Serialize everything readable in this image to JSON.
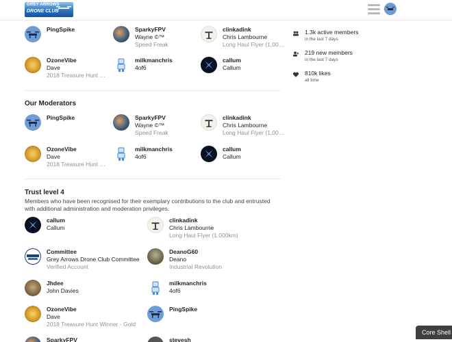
{
  "header": {
    "logo_line1": "GREY ARROWS",
    "logo_line2": "DRONE CLUB"
  },
  "top_group": [
    {
      "username": "PingSpike",
      "name": "",
      "title": "",
      "avatar": "drone-avatar"
    },
    {
      "username": "SparkyFPV",
      "name": "Wayne ©™",
      "title": "Speed Freak",
      "avatar": "photo-avatar"
    },
    {
      "username": "clinkadink",
      "name": "Chris Lambourne",
      "title": "Long Haul Flyer (1,00…",
      "avatar": "drone-silhouette-avatar"
    },
    {
      "username": "OzoneVibe",
      "name": "Dave",
      "title": "2018 Treasure Hunt …",
      "avatar": "sun-avatar"
    },
    {
      "username": "milkmanchris",
      "name": "4of6",
      "title": "",
      "avatar": "robot-avatar"
    },
    {
      "username": "callum",
      "name": "Callum",
      "title": "",
      "avatar": "x-logo-avatar"
    }
  ],
  "stats": [
    {
      "icon": "users-icon",
      "value": "1.3k active members",
      "sub": "in the last 7 days"
    },
    {
      "icon": "user-plus-icon",
      "value": "219 new members",
      "sub": "in the last 7 days"
    },
    {
      "icon": "heart-icon",
      "value": "810k likes",
      "sub": "all time"
    }
  ],
  "moderators": {
    "title": "Our Moderators",
    "members": [
      {
        "username": "PingSpike",
        "name": "",
        "title": ""
      },
      {
        "username": "SparkyFPV",
        "name": "Wayne ©™",
        "title": "Speed Freak"
      },
      {
        "username": "clinkadink",
        "name": "Chris Lambourne",
        "title": "Long Haul Flyer (1,00…"
      },
      {
        "username": "OzoneVibe",
        "name": "Dave",
        "title": "2018 Treasure Hunt …"
      },
      {
        "username": "milkmanchris",
        "name": "4of6",
        "title": ""
      },
      {
        "username": "callum",
        "name": "Callum",
        "title": ""
      }
    ]
  },
  "trust4": {
    "title": "Trust level 4",
    "description": "Members who have been recognised for their exemplary contributions to the club and entrusted with additional administration and moderation privileges.",
    "members": [
      {
        "username": "callum",
        "name": "Callum",
        "title": ""
      },
      {
        "username": "clinkadink",
        "name": "Chris Lambourne",
        "title": "Long Haul Flyer (1,000km)"
      },
      {
        "username": "Committee",
        "name": "Grey Arrows Drone Club Committee",
        "title": "Verified Account"
      },
      {
        "username": "DeanoG60",
        "name": "Deano",
        "title": "Industrial Revolution"
      },
      {
        "username": "Jhdee",
        "name": "John Davies",
        "title": ""
      },
      {
        "username": "milkmanchris",
        "name": "4of6",
        "title": ""
      },
      {
        "username": "OzoneVibe",
        "name": "Dave",
        "title": "2018 Treasure Hunt Winner - Gold"
      },
      {
        "username": "PingSpike",
        "name": "",
        "title": ""
      },
      {
        "username": "SparkyFPV",
        "name": "",
        "title": ""
      },
      {
        "username": "stevesh",
        "name": "",
        "title": ""
      }
    ]
  },
  "core_shell_label": "Core Shell"
}
